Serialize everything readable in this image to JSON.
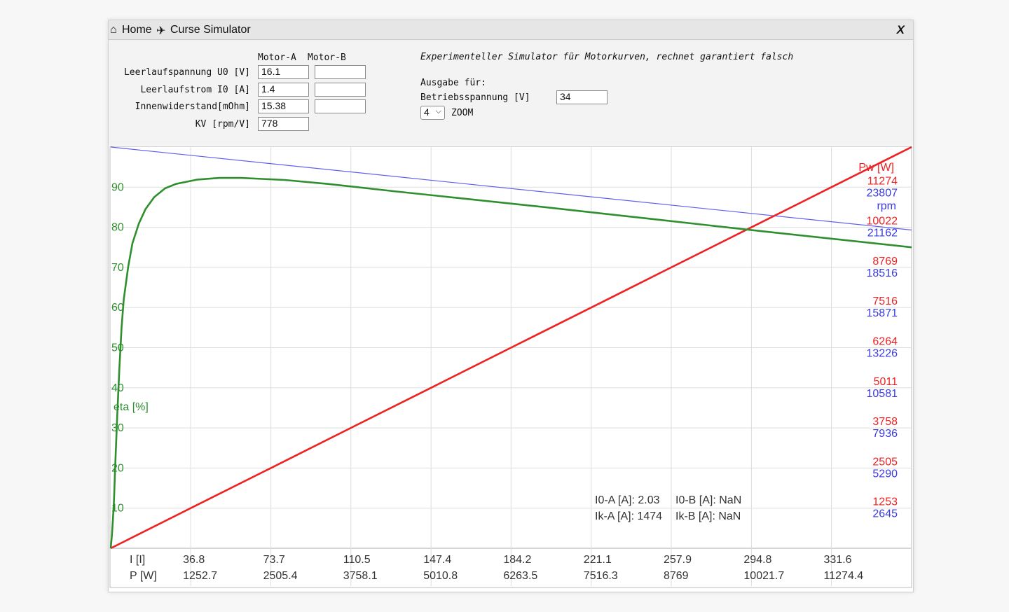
{
  "titlebar": {
    "home_icon": "⌂",
    "home_label": "Home",
    "arrow_icon": "✈",
    "title": "Curse Simulator",
    "close_label": "X"
  },
  "motors": {
    "header_a": "Motor-A",
    "header_b": "Motor-B",
    "rows": [
      {
        "label": "Leerlaufspannung U0 [V]",
        "a": "16.1",
        "b": ""
      },
      {
        "label": "Leerlaufstrom I0 [A]",
        "a": "1.4",
        "b": ""
      },
      {
        "label": "Innenwiderstand[mOhm]",
        "a": "15.38",
        "b": ""
      },
      {
        "label": "KV [rpm/V]",
        "a": "778"
      }
    ]
  },
  "output": {
    "subtitle": "Experimenteller Simulator für Motorkurven, rechnet garantiert falsch",
    "heading": "Ausgabe für:",
    "voltage_label": "Betriebsspannung [V]",
    "voltage_value": "34",
    "zoom_value": "4",
    "zoom_label": "ZOOM"
  },
  "chart_data": {
    "type": "line",
    "eta_label": "eta [%]",
    "eta_ticks": [
      "90",
      "80",
      "70",
      "60",
      "50",
      "40",
      "30",
      "20",
      "10"
    ],
    "right_power_label": "Pw [W]",
    "right_rpm_label": "rpm",
    "right_power_ticks": [
      "11274",
      "10022",
      "8769",
      "7516",
      "6264",
      "5011",
      "3758",
      "2505",
      "1253"
    ],
    "right_rpm_ticks": [
      "23807",
      "21162",
      "18516",
      "15871",
      "13226",
      "10581",
      "7936",
      "5290",
      "2645"
    ],
    "x_row1_label": "I [I]",
    "x_row2_label": "P [W]",
    "x_current_ticks": [
      "36.8",
      "73.7",
      "110.5",
      "147.4",
      "184.2",
      "221.1",
      "257.9",
      "294.8",
      "331.6"
    ],
    "x_power_ticks": [
      "1252.7",
      "2505.4",
      "3758.1",
      "5010.8",
      "6263.5",
      "7516.3",
      "8769",
      "10021.7",
      "11274.4"
    ],
    "info": {
      "i0a": "I0-A [A]: 2.03",
      "i0b": "I0-B [A]: NaN",
      "ika": "Ik-A [A]: 1474",
      "ikb": "Ik-B [A]: NaN"
    },
    "x_max_current": 368.5,
    "series": [
      {
        "name": "rpm",
        "color": "#6060ee",
        "x": [
          0,
          368.5
        ],
        "y": [
          26452,
          20983
        ]
      },
      {
        "name": "Pw [W]",
        "color": "#ee2222",
        "x": [
          0,
          36.8,
          73.7,
          110.5,
          147.4,
          184.2,
          221.1,
          257.9,
          294.8,
          331.6,
          368.5
        ],
        "y": [
          0,
          1253,
          2505,
          3758,
          5011,
          6264,
          7516,
          8769,
          10022,
          11274,
          12527
        ]
      },
      {
        "name": "eta [%]",
        "color": "#2f8f2f",
        "x": [
          0,
          0.5,
          1,
          1.5,
          2.03,
          3,
          4,
          5,
          6,
          8,
          10,
          13,
          16,
          20,
          25,
          30,
          40,
          50,
          60,
          80,
          100,
          130,
          160,
          200,
          250,
          300,
          368.5
        ],
        "y": [
          0,
          3,
          7,
          12,
          20,
          33,
          45,
          55,
          62,
          70,
          76,
          81,
          84.5,
          87.5,
          89.7,
          90.8,
          91.9,
          92.3,
          92.3,
          91.8,
          90.8,
          89,
          87.3,
          85,
          82,
          79,
          75
        ]
      }
    ]
  }
}
